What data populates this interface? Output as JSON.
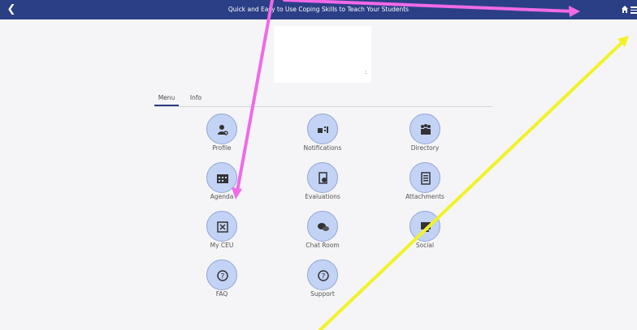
{
  "header": {
    "back_icon": "chevron-left-icon",
    "title": "Quick and Easy to Use Coping Skills to Teach Your Students",
    "home_icon": "home-icon",
    "menu_icon": "hamburger-menu-icon",
    "bar_color": "#2b3f86"
  },
  "logo": {
    "mark": ":"
  },
  "tabs": [
    {
      "label": "Menu",
      "active": true
    },
    {
      "label": "Info",
      "active": false
    }
  ],
  "menu_tiles": [
    {
      "label": "Profile",
      "icon": "profile-search-icon"
    },
    {
      "label": "Notifications",
      "icon": "notifications-icon"
    },
    {
      "label": "Directory",
      "icon": "directory-people-icon"
    },
    {
      "label": "Agenda",
      "icon": "agenda-calendar-icon"
    },
    {
      "label": "Evaluations",
      "icon": "evaluations-icon"
    },
    {
      "label": "Attachments",
      "icon": "attachments-icon"
    },
    {
      "label": "My CEU",
      "icon": "ceu-certificate-icon"
    },
    {
      "label": "Chat Room",
      "icon": "chat-bubbles-icon"
    },
    {
      "label": "Social",
      "icon": "social-icon"
    },
    {
      "label": "FAQ",
      "icon": "faq-question-icon"
    },
    {
      "label": "Support",
      "icon": "support-question-icon"
    }
  ],
  "colors": {
    "tile_circle": "#c3d3f6",
    "tile_border": "#93a6d4",
    "annotation_pink": "#f06ae8",
    "annotation_yellow": "#f2f227"
  }
}
